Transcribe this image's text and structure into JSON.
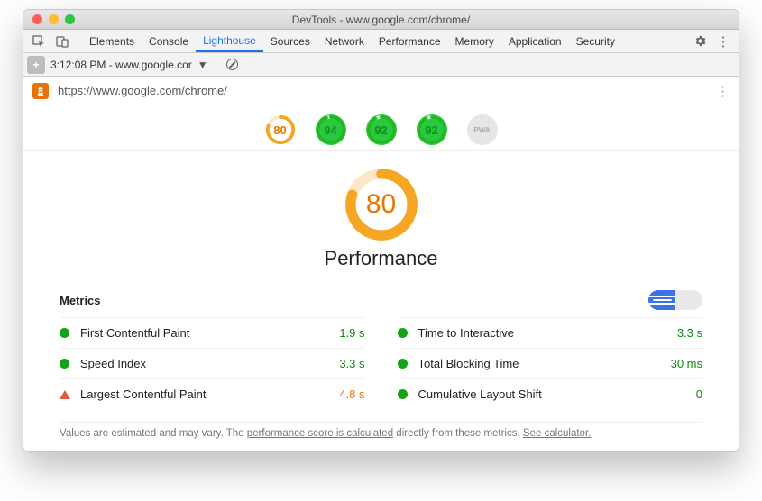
{
  "window": {
    "title": "DevTools - www.google.com/chrome/"
  },
  "tabs": {
    "items": [
      "Elements",
      "Console",
      "Lighthouse",
      "Sources",
      "Network",
      "Performance",
      "Memory",
      "Application",
      "Security"
    ],
    "active": "Lighthouse"
  },
  "toolbar": {
    "timestamp": "3:12:08 PM - www.google.cor"
  },
  "urlbar": {
    "url": "https://www.google.com/chrome/"
  },
  "summary_gauges": [
    {
      "score": "80",
      "tone": "orange",
      "pct": 80
    },
    {
      "score": "94",
      "tone": "green",
      "pct": 94
    },
    {
      "score": "92",
      "tone": "green",
      "pct": 92
    },
    {
      "score": "92",
      "tone": "green",
      "pct": 92
    },
    {
      "score": "PWA",
      "tone": "gray",
      "pct": 0
    }
  ],
  "main_gauge": {
    "score": "80",
    "title": "Performance",
    "pct": 80
  },
  "metrics_header": "Metrics",
  "metrics": [
    {
      "name": "First Contentful Paint",
      "value": "1.9 s",
      "tone": "good",
      "mark": "dot"
    },
    {
      "name": "Time to Interactive",
      "value": "3.3 s",
      "tone": "good",
      "mark": "dot"
    },
    {
      "name": "Speed Index",
      "value": "3.3 s",
      "tone": "good",
      "mark": "dot"
    },
    {
      "name": "Total Blocking Time",
      "value": "30 ms",
      "tone": "good",
      "mark": "dot"
    },
    {
      "name": "Largest Contentful Paint",
      "value": "4.8 s",
      "tone": "ok",
      "mark": "tri"
    },
    {
      "name": "Cumulative Layout Shift",
      "value": "0",
      "tone": "good",
      "mark": "dot"
    }
  ],
  "footnote": {
    "p1": "Values are estimated and may vary. The ",
    "l1": "performance score is calculated",
    "p2": " directly from these metrics. ",
    "l2": "See calculator."
  }
}
